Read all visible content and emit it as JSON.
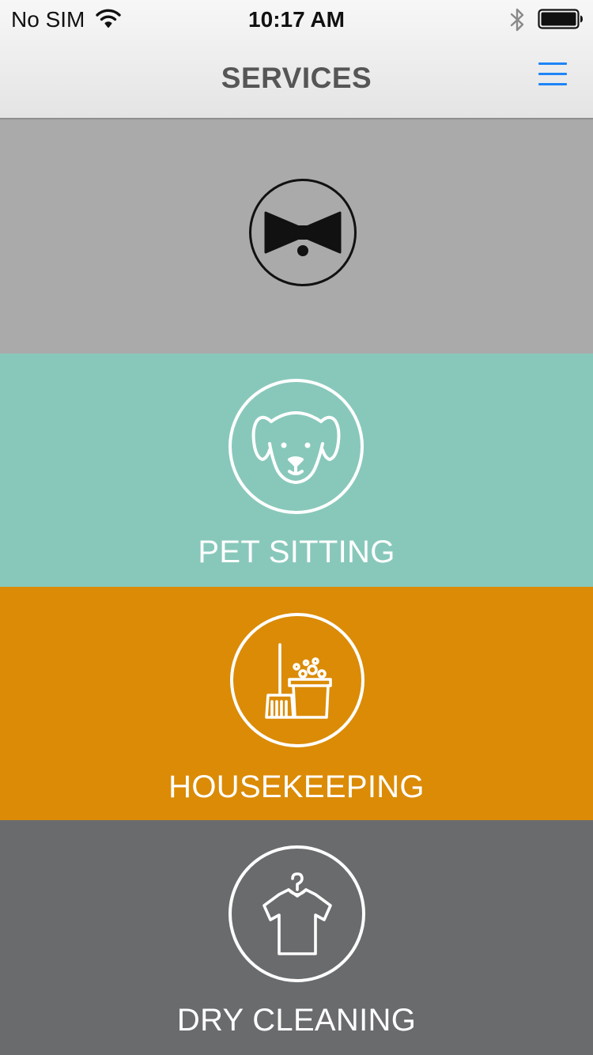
{
  "status_bar": {
    "carrier": "No SIM",
    "time": "10:17 AM",
    "wifi_icon": "wifi-icon",
    "bluetooth_icon": "bluetooth-icon",
    "battery_icon": "battery-icon"
  },
  "nav": {
    "title": "SERVICES",
    "menu_icon": "hamburger-menu-icon",
    "accent_color": "#1f84f7"
  },
  "services": [
    {
      "label": "",
      "icon": "bowtie-icon",
      "color": "#aaaaaa"
    },
    {
      "label": "PET SITTING",
      "icon": "dog-icon",
      "color": "#88c8bb"
    },
    {
      "label": "HOUSEKEEPING",
      "icon": "broom-bucket-icon",
      "color": "#db8b06"
    },
    {
      "label": "DRY CLEANING",
      "icon": "shirt-hanger-icon",
      "color": "#6a6b6d"
    }
  ]
}
